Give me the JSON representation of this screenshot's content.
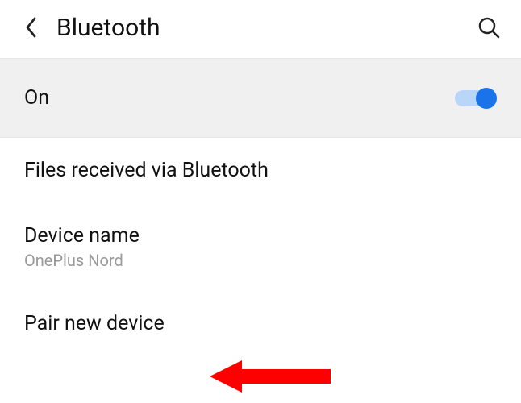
{
  "header": {
    "title": "Bluetooth"
  },
  "toggle": {
    "state_label": "On",
    "enabled": true
  },
  "items": {
    "files_received": "Files received via Bluetooth",
    "device_name_label": "Device name",
    "device_name_value": "OnePlus Nord",
    "pair_new": "Pair new device"
  }
}
